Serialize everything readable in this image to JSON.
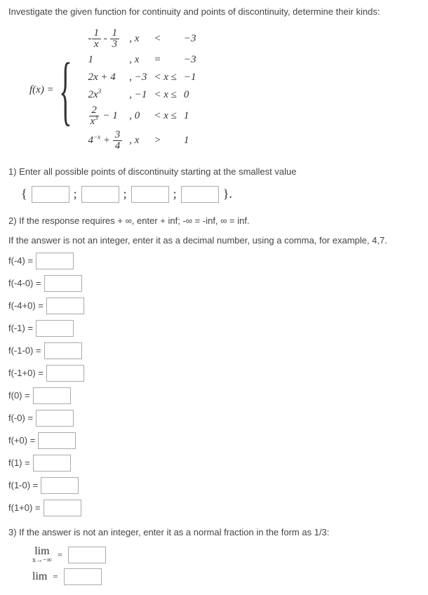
{
  "title": "Investigate the given function for continuity and points of discontinuity, determine their kinds:",
  "fn": {
    "name": "f(x) =",
    "rows": [
      {
        "expr_html": "-<span class='frac'><span class='num'>1</span><span class='den'>x</span></span> - <span class='frac'><span class='num'>1</span><span class='den'>3</span></span>",
        "var": ", x",
        "rel": "<",
        "bound": "−3"
      },
      {
        "expr_html": "1",
        "var": ", x",
        "rel": "=",
        "bound": "−3"
      },
      {
        "expr_html": "2<i>x</i> + 4",
        "var": ", −3",
        "rel": "< x ≤",
        "bound": "−1"
      },
      {
        "expr_html": "2<i>x</i><sup>3</sup>",
        "var": ", −1",
        "rel": "< x ≤",
        "bound": "0"
      },
      {
        "expr_html": "<span class='frac'><span class='num'>2</span><span class='den'>x<sup>3</sup></span></span> − 1",
        "var": ", 0",
        "rel": "< x ≤",
        "bound": "1"
      },
      {
        "expr_html": "4<sup>−x</sup> + <span class='frac'><span class='num'>3</span><span class='den'>4</span></span>",
        "var": ", x",
        "rel": ">",
        "bound": "1"
      }
    ]
  },
  "q1": "1)   Enter all possible points of discontinuity starting at the smallest value",
  "q2": "2)   If the response requires + ∞, enter + inf; -∞ = -inf, ∞ = inf.",
  "q2_hint": "If the answer is not an integer, enter it as a decimal number, using a comma, for example, 4,7.",
  "fields": [
    "f(-4) =",
    "f(-4-0) =",
    "f(-4+0) =",
    "f(-1) =",
    "f(-1-0) =",
    "f(-1+0) =",
    "f(0) =",
    "f(-0) =",
    "f(+0) =",
    "f(1) =",
    "f(1-0) =",
    "f(1+0) ="
  ],
  "q3": "3)   If the answer is not an integer, enter it as a normal fraction in the form as 1/3:",
  "lim1_sub": "x→−∞",
  "lim2_sub": "",
  "lim_label": "lim",
  "eq": "=",
  "set_open": "{",
  "set_sep": ";",
  "set_close": "}."
}
